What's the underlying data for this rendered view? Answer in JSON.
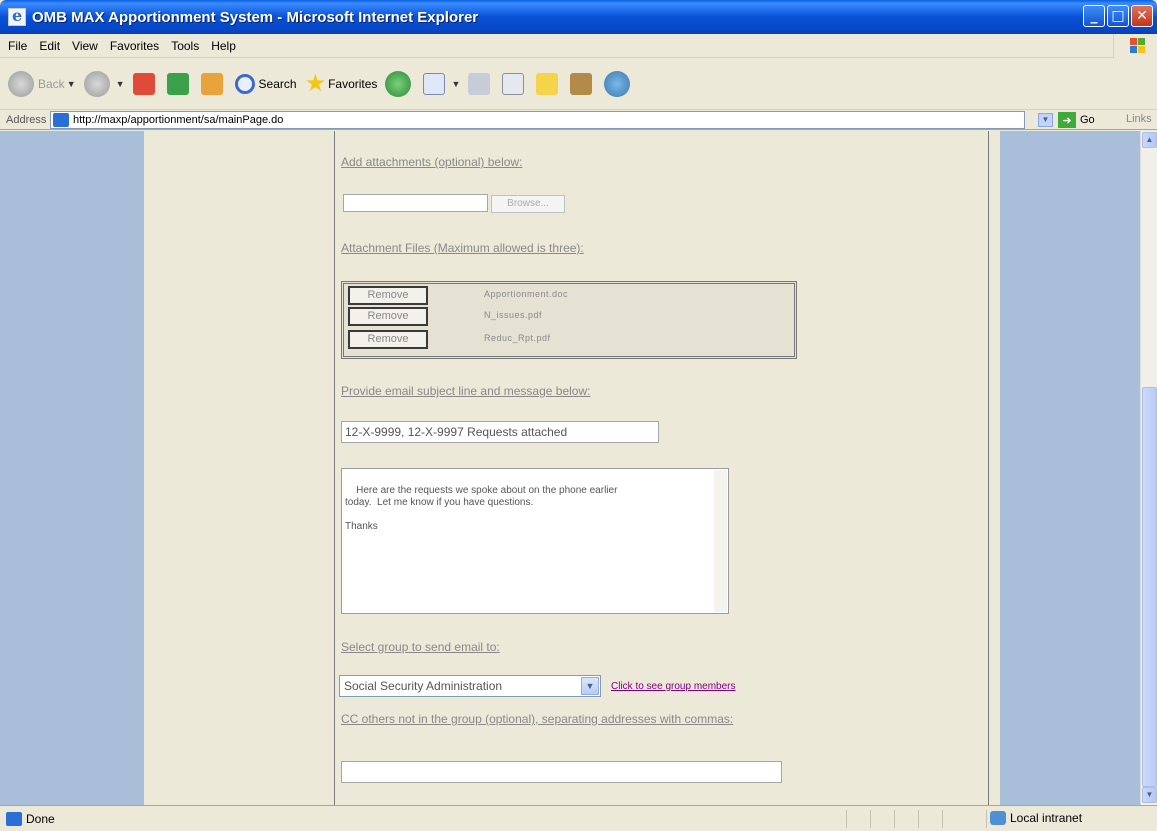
{
  "window": {
    "title": "OMB MAX Apportionment System - Microsoft Internet Explorer"
  },
  "menu": [
    "File",
    "Edit",
    "View",
    "Favorites",
    "Tools",
    "Help"
  ],
  "toolbar": {
    "back": "Back",
    "search": "Search",
    "favorites": "Favorites"
  },
  "address": {
    "label": "Address",
    "url": "http://maxp/apportionment/sa/mainPage.do",
    "go": "Go",
    "links": "Links"
  },
  "form": {
    "attachments_label": "Add attachments (optional) below:",
    "browse_label": "Browse...",
    "attachment_files_label": "Attachment Files (Maximum allowed is three):",
    "remove_label": "Remove",
    "attachments": [
      "Apportionment.doc",
      "N_issues.pdf",
      "Reduc_Rpt.pdf"
    ],
    "email_label": "Provide email subject line and message below:",
    "subject_value": "12-X-9999, 12-X-9997 Requests attached",
    "message_value": "Here are the requests we spoke about on the phone earlier\ntoday.  Let me know if you have questions.\n\nThanks",
    "group_label": "Select group to send email to:",
    "group_value": "Social Security Administration",
    "group_link": "Click to see group members",
    "cc_label": "CC others not in the group (optional), separating addresses with commas:"
  },
  "status": {
    "text": "Done",
    "zone": "Local intranet"
  }
}
